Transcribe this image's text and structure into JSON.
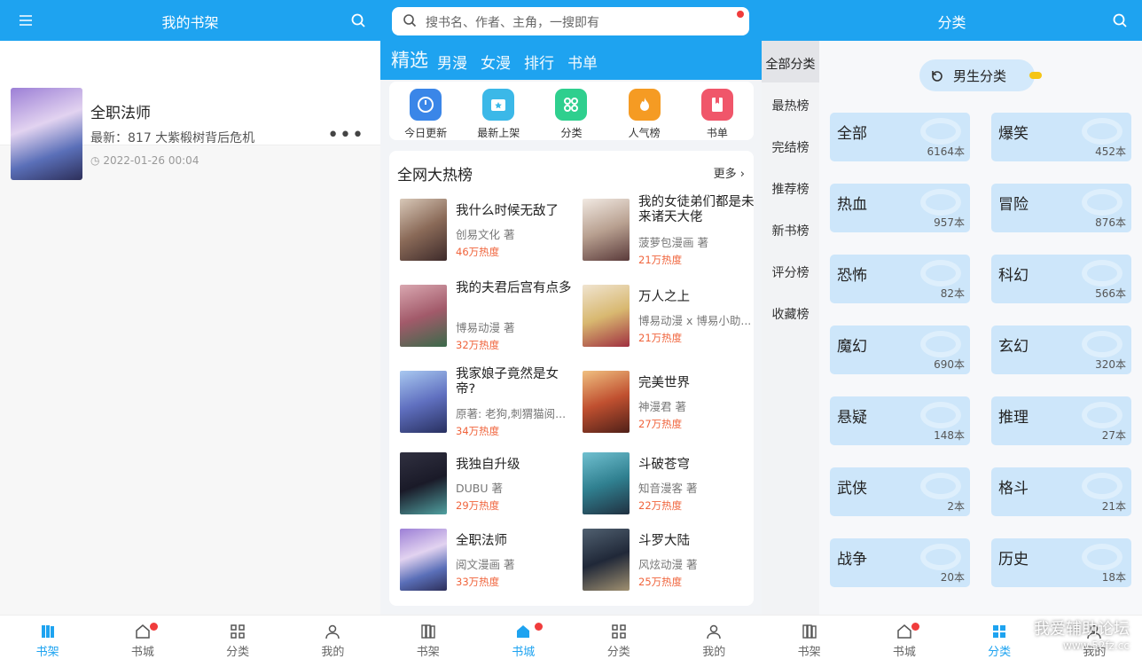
{
  "shelf": {
    "title": "我的书架",
    "book": {
      "title": "全职法师",
      "latest": "最新：817 大紫椴树背后危机",
      "time": "2022-01-26 00:04"
    },
    "tabs": [
      "书架",
      "书城",
      "分类",
      "我的"
    ]
  },
  "store": {
    "search_placeholder": "搜书名、作者、主角，一搜即有",
    "categories": [
      "精选",
      "男漫",
      "女漫",
      "排行",
      "书单"
    ],
    "quick": [
      {
        "label": "今日更新",
        "color": "#3a86e8"
      },
      {
        "label": "最新上架",
        "color": "#3bb8e8"
      },
      {
        "label": "分类",
        "color": "#2fcf8e"
      },
      {
        "label": "人气榜",
        "color": "#f59b23"
      },
      {
        "label": "书单",
        "color": "#f0566a"
      }
    ],
    "hot_title": "全网大热榜",
    "hot_more": "更多",
    "books": [
      {
        "title": "我什么时候无敌了",
        "author": "创易文化 著",
        "heat": "46万热度"
      },
      {
        "title": "我的女徒弟们都是未来诸天大佬",
        "author": "菠萝包漫画 著",
        "heat": "21万热度"
      },
      {
        "title": "我的夫君后宫有点多",
        "author": "博易动漫 著",
        "heat": "32万热度"
      },
      {
        "title": "万人之上",
        "author": "博易动漫 x 博易小助...",
        "heat": "21万热度"
      },
      {
        "title": "我家娘子竟然是女帝?",
        "author": "原著: 老狗,刺猬猫阅...",
        "heat": "34万热度"
      },
      {
        "title": "完美世界",
        "author": "神漫君 著",
        "heat": "27万热度"
      },
      {
        "title": "我独自升级",
        "author": "DUBU 著",
        "heat": "29万热度"
      },
      {
        "title": "斗破苍穹",
        "author": "知音漫客 著",
        "heat": "22万热度"
      },
      {
        "title": "全职法师",
        "author": "阅文漫画 著",
        "heat": "33万热度"
      },
      {
        "title": "斗罗大陆",
        "author": "风炫动漫 著",
        "heat": "25万热度"
      }
    ],
    "tabs": [
      "书架",
      "书城",
      "分类",
      "我的"
    ]
  },
  "category": {
    "title": "分类",
    "side": [
      "全部分类",
      "最热榜",
      "完结榜",
      "推荐榜",
      "新书榜",
      "评分榜",
      "收藏榜"
    ],
    "gender": "男生分类",
    "items": [
      {
        "name": "全部",
        "count": "6164本"
      },
      {
        "name": "爆笑",
        "count": "452本"
      },
      {
        "name": "热血",
        "count": "957本"
      },
      {
        "name": "冒险",
        "count": "876本"
      },
      {
        "name": "恐怖",
        "count": "82本"
      },
      {
        "name": "科幻",
        "count": "566本"
      },
      {
        "name": "魔幻",
        "count": "690本"
      },
      {
        "name": "玄幻",
        "count": "320本"
      },
      {
        "name": "悬疑",
        "count": "148本"
      },
      {
        "name": "推理",
        "count": "27本"
      },
      {
        "name": "武侠",
        "count": "2本"
      },
      {
        "name": "格斗",
        "count": "21本"
      },
      {
        "name": "战争",
        "count": "20本"
      },
      {
        "name": "历史",
        "count": "18本"
      }
    ],
    "tabs": [
      "书架",
      "书城",
      "分类",
      "我的"
    ]
  },
  "watermark": {
    "line1": "我爱辅助论坛",
    "line2": "www.52fz.cc"
  }
}
